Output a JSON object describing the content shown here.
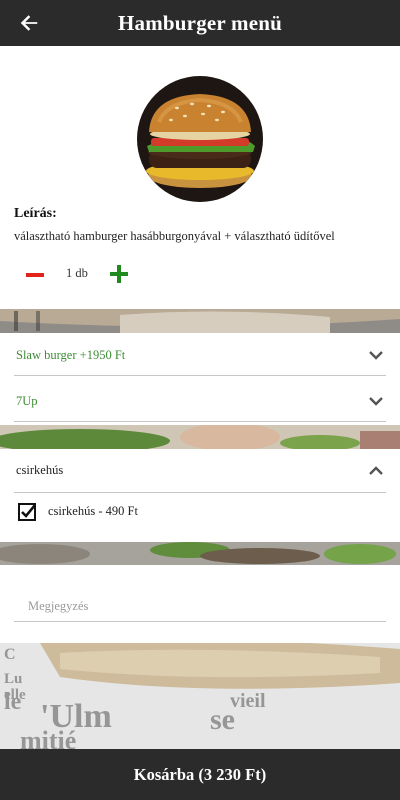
{
  "header": {
    "title": "Hamburger menü",
    "back_icon": "arrow-left-icon"
  },
  "product": {
    "image": "burger-photo",
    "description_title": "Leírás:",
    "description": "választható hamburger hasábburgonyával + választható üdítővel"
  },
  "quantity": {
    "value": "1 db",
    "minus_color": "#e2231a",
    "plus_color": "#1f8a1f"
  },
  "options": [
    {
      "label": "Slaw burger +1950 Ft"
    },
    {
      "label": "7Up"
    }
  ],
  "extras": {
    "title": "csirkehús",
    "items": [
      {
        "label": "csirkehús - 490 Ft",
        "checked": true
      }
    ]
  },
  "note": {
    "placeholder": "Megjegyzés"
  },
  "footer": {
    "cart_label": "Kosárba (3 230 Ft)"
  },
  "colors": {
    "bar": "#2b2b2b",
    "option_text": "#3d8c34"
  }
}
